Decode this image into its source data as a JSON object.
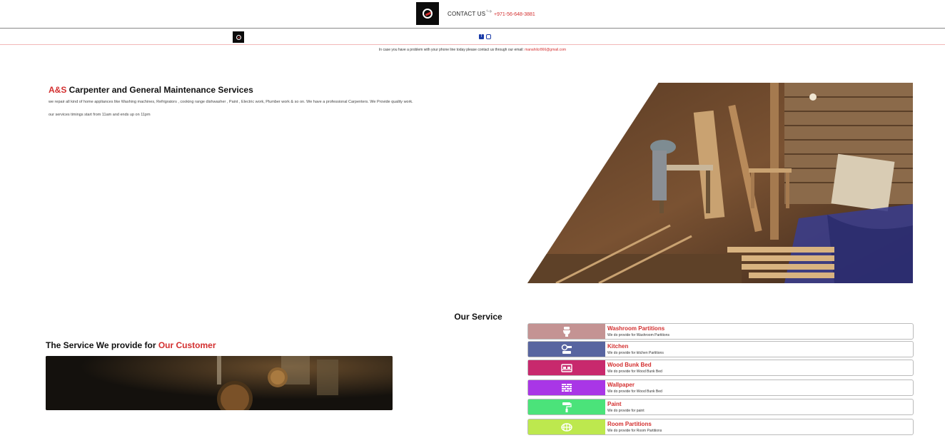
{
  "header": {
    "contact_label": "CONTACT US",
    "phone": "+971-56-648-3881"
  },
  "notice": {
    "text": "In case you have a problem with your phone line today please contact us through our email: ",
    "email": "manahilcr866@gmail.com"
  },
  "hero": {
    "brand": "A&S",
    "title_rest": " Carpenter and General Maintenance Services",
    "description": "we repair all kind of home appliances like Washing machines, Refrigrators , cooking range dishwasher , Paint , Electric work, Plumber work & so on. We have a professional Carpenters. We Provide quality work.",
    "timing": "our services timings start from 11am and ends up on 11pm"
  },
  "section": {
    "our_service": "Our Service",
    "provide_prefix": "The Service We provide for ",
    "provide_accent": "Our Customer"
  },
  "services": [
    {
      "name": "Washroom Partitions",
      "desc": "We do provide for Washroom Partitions",
      "color": "#c49393",
      "icon": "toilet-icon"
    },
    {
      "name": "Kitchen",
      "desc": "We do provide for kitchen Partitions",
      "color": "#5865a0",
      "icon": "kitchen-icon"
    },
    {
      "name": "Wood Bunk Bed",
      "desc": "We do provide for Wood Bunk Bed",
      "color": "#c8296d",
      "icon": "bed-icon"
    },
    {
      "name": "Wallpaper",
      "desc": "We do provide for Wood Bunk Bed",
      "color": "#a936e6",
      "icon": "brick-wall-icon"
    },
    {
      "name": "Paint",
      "desc": "We do provide for paint",
      "color": "#4be37a",
      "icon": "paint-roller-icon"
    },
    {
      "name": "Room Partitions",
      "desc": "We do provide for Room Partitions",
      "color": "#bde84e",
      "icon": "partition-icon"
    }
  ],
  "colors": {
    "accent": "#d32f2f",
    "social": "#1a3ba8"
  }
}
